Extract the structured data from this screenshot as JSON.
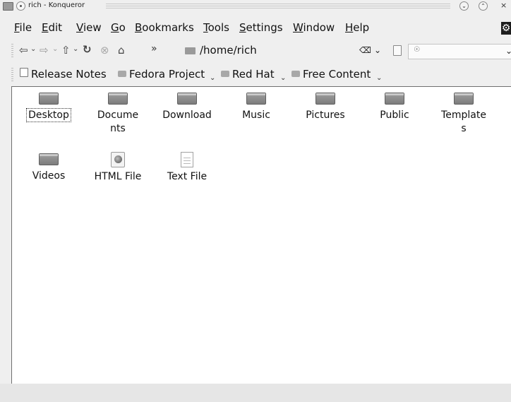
{
  "window": {
    "title": "rich - Konqueror",
    "close_glyph": "×"
  },
  "menu": [
    "File",
    "Edit",
    "View",
    "Go",
    "Bookmarks",
    "Tools",
    "Settings",
    "Window",
    "Help"
  ],
  "menu_accel": [
    "F",
    "E",
    "V",
    "G",
    "B",
    "T",
    "S",
    "W",
    "H"
  ],
  "navbar": {
    "icons": [
      "back-icon",
      "forward-icon",
      "up-icon",
      "reload-icon",
      "stop-icon",
      "home-icon"
    ],
    "more": "»",
    "location": "/home/rich",
    "search_placeholder": ""
  },
  "bookmarks": [
    {
      "label": "Release Notes",
      "icon": "page-icon",
      "dropdown": false
    },
    {
      "label": "Fedora Project",
      "icon": "folder-icon",
      "dropdown": true
    },
    {
      "label": "Red Hat",
      "icon": "folder-icon",
      "dropdown": true
    },
    {
      "label": "Free Content",
      "icon": "folder-icon",
      "dropdown": true
    }
  ],
  "files": [
    {
      "name": "Desktop",
      "type": "folder",
      "selected": true
    },
    {
      "name": "Documents",
      "type": "folder",
      "selected": false
    },
    {
      "name": "Download",
      "type": "folder",
      "selected": false
    },
    {
      "name": "Music",
      "type": "folder",
      "selected": false
    },
    {
      "name": "Pictures",
      "type": "folder",
      "selected": false
    },
    {
      "name": "Public",
      "type": "folder",
      "selected": false
    },
    {
      "name": "Templates",
      "type": "folder",
      "selected": false
    },
    {
      "name": "Videos",
      "type": "folder",
      "selected": false
    },
    {
      "name": "HTML File",
      "type": "html",
      "selected": false
    },
    {
      "name": "Text File",
      "type": "text",
      "selected": false
    }
  ],
  "status": {
    "text": ""
  },
  "colors": {
    "window_bg": "#efefef",
    "view_bg": "#ffffff",
    "folder": "#8c8c8c"
  }
}
